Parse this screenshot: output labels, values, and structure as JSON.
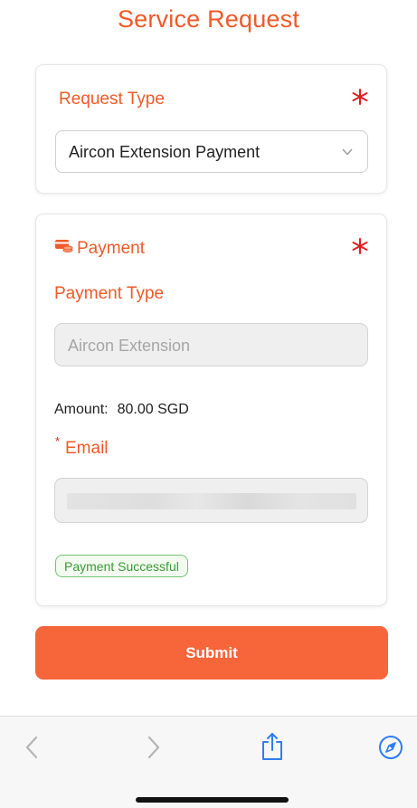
{
  "page": {
    "title": "Service Request"
  },
  "request_section": {
    "label": "Request Type",
    "selected_value": "Aircon Extension Payment"
  },
  "payment_section": {
    "header": "Payment",
    "payment_type_label": "Payment Type",
    "payment_type_value": "Aircon Extension",
    "amount_label": "Amount:",
    "amount_value": "80.00 SGD",
    "email_required_mark": "*",
    "email_label": "Email",
    "status_badge": "Payment Successful"
  },
  "actions": {
    "submit_label": "Submit"
  },
  "browser_toolbar": {
    "icons": [
      "back-icon",
      "forward-icon",
      "share-icon",
      "compass-icon"
    ]
  },
  "colors": {
    "accent": "#f05a28",
    "required": "#e02020",
    "submit_bg": "#f7653a",
    "success": "#3a9a36",
    "ios_blue": "#2f7cf6"
  }
}
